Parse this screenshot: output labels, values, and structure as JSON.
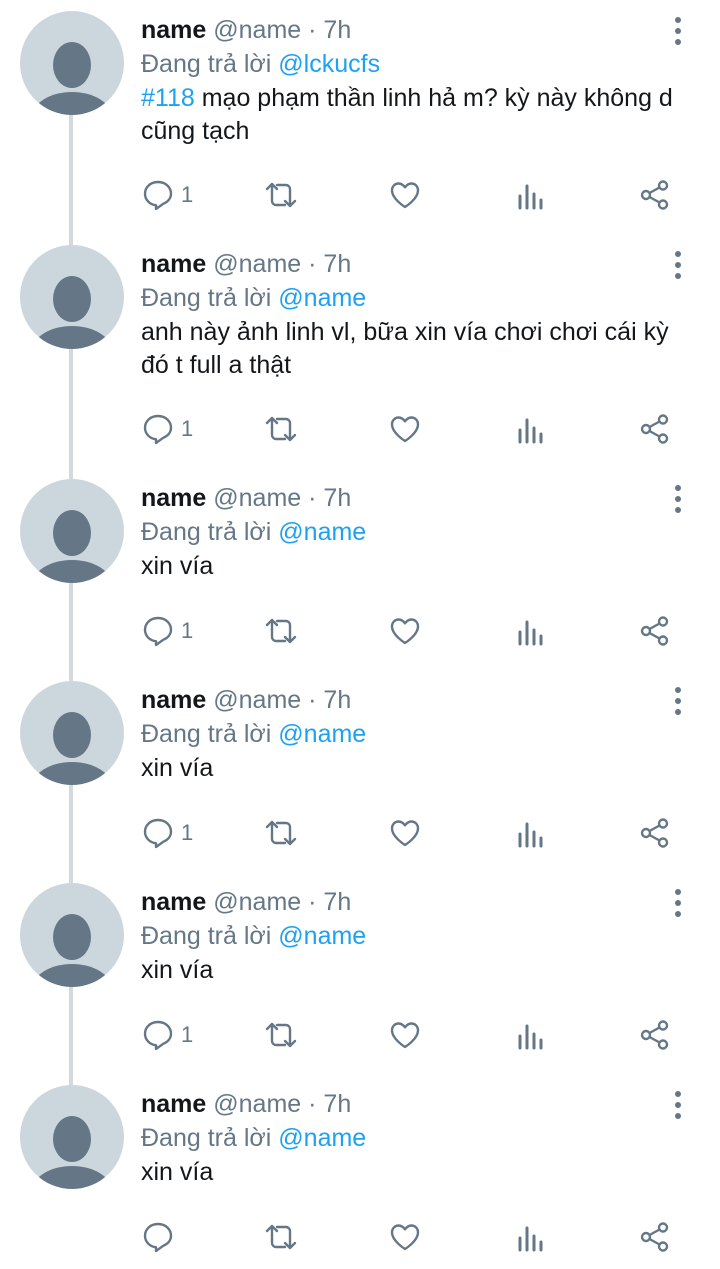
{
  "tweets": [
    {
      "name": "name",
      "handle": "@name",
      "time": "7h",
      "replying_prefix": "Đang trả lời",
      "replying_to": "@lckucfs",
      "hashtag": "#118",
      "text": " mạo phạm thần linh hả m? kỳ này không d cũng tạch",
      "reply_count": "1"
    },
    {
      "name": "name",
      "handle": "@name",
      "time": "7h",
      "replying_prefix": "Đang trả lời",
      "replying_to": "@name",
      "text": "anh này ảnh linh vl, bữa xin vía chơi chơi cái kỳ đó t full a thật",
      "reply_count": "1"
    },
    {
      "name": "name",
      "handle": "@name",
      "time": "7h",
      "replying_prefix": "Đang trả lời",
      "replying_to": "@name",
      "text": "xin vía",
      "reply_count": "1"
    },
    {
      "name": "name",
      "handle": "@name",
      "time": "7h",
      "replying_prefix": "Đang trả lời",
      "replying_to": "@name",
      "text": "xin vía",
      "reply_count": "1"
    },
    {
      "name": "name",
      "handle": "@name",
      "time": "7h",
      "replying_prefix": "Đang trả lời",
      "replying_to": "@name",
      "text": "xin vía",
      "reply_count": "1"
    },
    {
      "name": "name",
      "handle": "@name",
      "time": "7h",
      "replying_prefix": "Đang trả lời",
      "replying_to": "@name",
      "text": "xin vía",
      "reply_count": ""
    }
  ],
  "separator": "·",
  "icons": {
    "reply": "reply-icon",
    "retweet": "retweet-icon",
    "like": "like-icon",
    "analytics": "analytics-icon",
    "share": "share-icon",
    "more": "more-vertical-icon"
  },
  "colors": {
    "text": "#14171a",
    "muted": "#657786",
    "accent": "#1da1f2",
    "avatar_bg": "#ccd6dd",
    "avatar_fg": "#657786",
    "thread_line": "#d6d9dc"
  }
}
